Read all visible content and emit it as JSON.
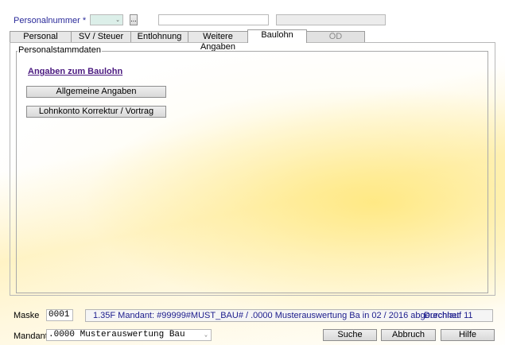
{
  "header": {
    "personalnummer_label": "Personalnummer *",
    "ellipsis_button": "...",
    "name_field_value": "",
    "extra_field_value": ""
  },
  "tabs": [
    {
      "label": "Personal",
      "state": "normal"
    },
    {
      "label": "SV / Steuer",
      "state": "normal"
    },
    {
      "label": "Entlohnung",
      "state": "normal"
    },
    {
      "label": "Weitere Angaben",
      "state": "normal"
    },
    {
      "label": "Baulohn",
      "state": "active"
    },
    {
      "label": "ÖD",
      "state": "disabled"
    }
  ],
  "group": {
    "title": "Personalstammdaten",
    "section_link": "Angaben zum Baulohn",
    "buttons": [
      "Allgemeine Angaben",
      "Lohnkonto Korrektur / Vortrag"
    ]
  },
  "footer": {
    "maske_label": "Maske",
    "maske_value": "0001",
    "status_text": "1.35F Mandant: #99999#MUST_BAU# / .0000 Musterauswertung Ba in 02 / 2016 abgerechnet",
    "durchlauf": "Durchlauf 11",
    "mandant_label": "Mandant",
    "mandant_value": ".0000 Musterauswertung Bau",
    "buttons": {
      "suche": "Suche",
      "abbruch": "Abbruch",
      "hilfe": "Hilfe"
    }
  },
  "colors": {
    "accent_link": "#4b1a80",
    "status_text": "#1c1c8c",
    "required_label": "#2a2a9a",
    "background_glow": "#ffe778"
  }
}
